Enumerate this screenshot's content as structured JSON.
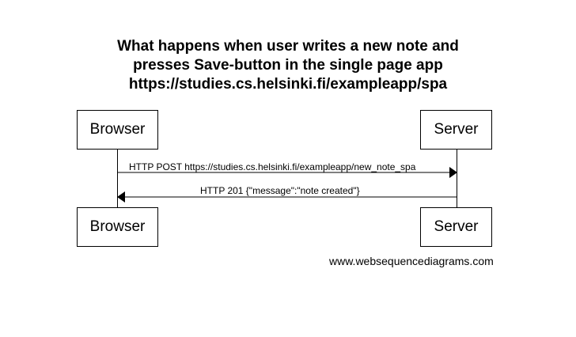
{
  "title": {
    "line1": "What happens when user writes a new note and",
    "line2": "presses Save-button in the single page app",
    "line3": "https://studies.cs.helsinki.fi/exampleapp/spa"
  },
  "participants": {
    "browser": "Browser",
    "server": "Server"
  },
  "messages": [
    {
      "from": "Browser",
      "to": "Server",
      "label": "HTTP POST https://studies.cs.helsinki.fi/exampleapp/new_note_spa"
    },
    {
      "from": "Server",
      "to": "Browser",
      "label": "HTTP 201 {\"message\":\"note created\"}"
    }
  ],
  "watermark": "www.websequencediagrams.com"
}
